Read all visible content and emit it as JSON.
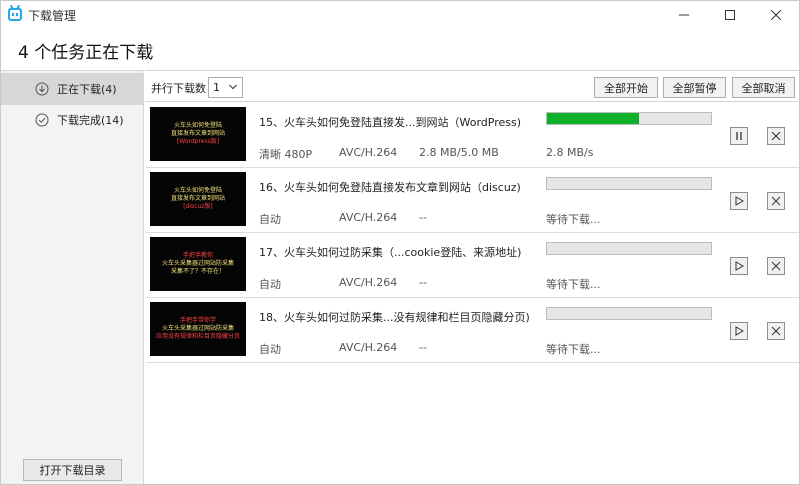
{
  "window": {
    "title": "下载管理"
  },
  "heading": "4 个任务正在下载",
  "sidebar": {
    "items": [
      {
        "label": "正在下载(4)",
        "icon": "download-circle-icon"
      },
      {
        "label": "下载完成(14)",
        "icon": "check-circle-icon"
      }
    ],
    "open_dir_label": "打开下载目录"
  },
  "toolbar": {
    "parallel_label": "并行下载数",
    "parallel_value": "1",
    "start_all": "全部开始",
    "pause_all": "全部暂停",
    "cancel_all": "全部取消"
  },
  "tasks": [
    {
      "title": "15、火车头如何免登陆直接发...到网站（WordPress)",
      "quality": "清晰 480P",
      "codec": "AVC/H.264",
      "size": "2.8 MB/5.0 MB",
      "status": "2.8 MB/s",
      "progress": 0.56,
      "thumb": {
        "line1": "火车头如何免登陆",
        "line2": "直接发布文章到网站",
        "line3": "[Wordpress版]"
      }
    },
    {
      "title": "16、火车头如何免登陆直接发布文章到网站（discuz)",
      "quality": "自动",
      "codec": "AVC/H.264",
      "size": "--",
      "status": "等待下载...",
      "progress": 0,
      "thumb": {
        "line1": "火车头如何免登陆",
        "line2": "直接发布文章到网站",
        "line3": "[discuz版]"
      }
    },
    {
      "title": "17、火车头如何过防采集（...cookie登陆、来源地址)",
      "quality": "自动",
      "codec": "AVC/H.264",
      "size": "--",
      "status": "等待下载...",
      "progress": 0,
      "thumb": {
        "line1": "手把手教你",
        "line2": "火车头采集器过网站防采集",
        "line3": "采集不了？不存在！"
      }
    },
    {
      "title": "18、火车头如何过防采集...没有规律和栏目页隐藏分页)",
      "quality": "自动",
      "codec": "AVC/H.264",
      "size": "--",
      "status": "等待下载...",
      "progress": 0,
      "thumb": {
        "line1": "手把手带你学",
        "line2": "火车头采集器过网站防采集",
        "line3": "应用没有规律和栏目页隐藏分页"
      }
    }
  ],
  "colors": {
    "progress": "#0fb12a",
    "accent": "#23a8e8"
  }
}
